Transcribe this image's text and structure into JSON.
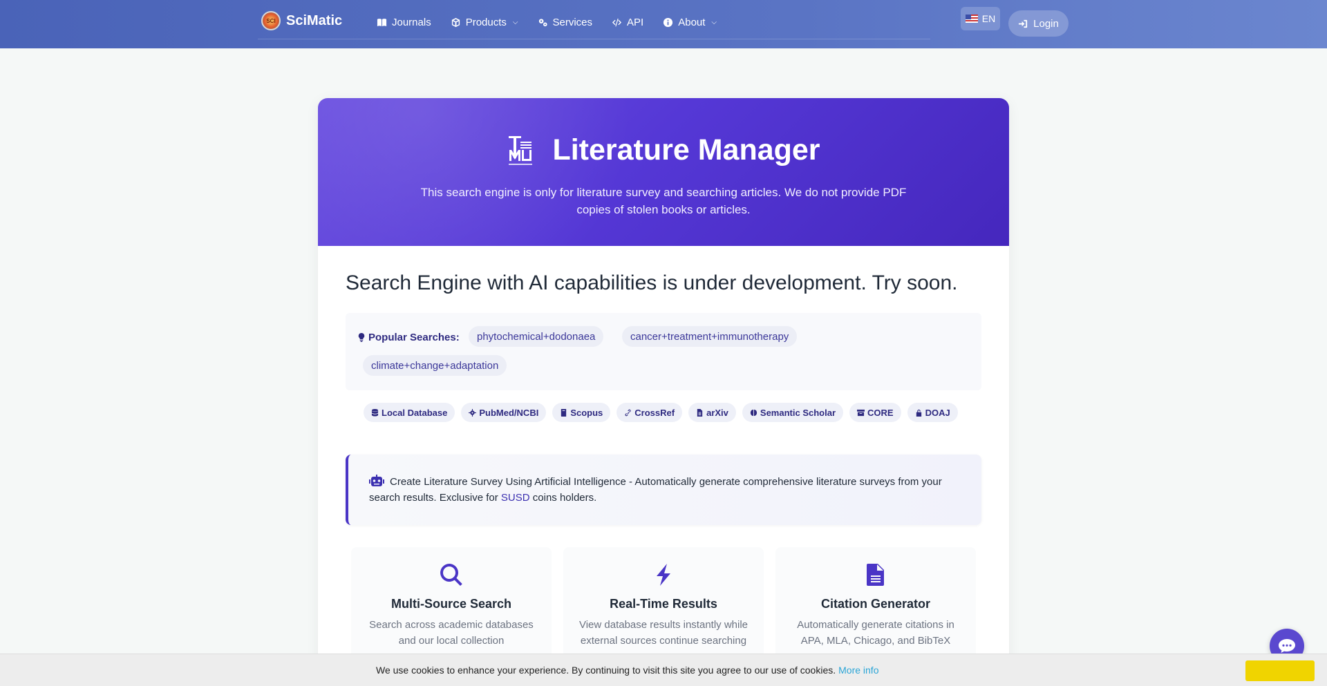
{
  "navbar": {
    "brand": "SciMatic",
    "logo_text": "SCI",
    "items": [
      {
        "label": "Journals",
        "icon": "book-icon",
        "dropdown": false
      },
      {
        "label": "Products",
        "icon": "box-icon",
        "dropdown": true
      },
      {
        "label": "Services",
        "icon": "gears-icon",
        "dropdown": false
      },
      {
        "label": "API",
        "icon": "code-icon",
        "dropdown": false
      },
      {
        "label": "About",
        "icon": "info-circle-icon",
        "dropdown": true
      }
    ],
    "language": "EN",
    "login_label": "Login"
  },
  "hero": {
    "title": "Literature Manager",
    "subtitle": "This search engine is only for literature survey and searching articles. We do not provide PDF copies of stolen books or articles."
  },
  "main": {
    "heading": "Search Engine with AI capabilities is under development. Try soon."
  },
  "popular": {
    "label": "Popular Searches:",
    "tags": [
      "phytochemical+dodonaea",
      "cancer+treatment+immunotherapy",
      "climate+change+adaptation"
    ]
  },
  "sources": [
    {
      "label": "Local Database",
      "icon": "database-icon"
    },
    {
      "label": "PubMed/NCBI",
      "icon": "virus-icon"
    },
    {
      "label": "Scopus",
      "icon": "book-icon"
    },
    {
      "label": "CrossRef",
      "icon": "link-icon"
    },
    {
      "label": "arXiv",
      "icon": "file-icon"
    },
    {
      "label": "Semantic Scholar",
      "icon": "brain-icon"
    },
    {
      "label": "CORE",
      "icon": "archive-icon"
    },
    {
      "label": "DOAJ",
      "icon": "unlock-icon"
    }
  ],
  "ai_box": {
    "text_before": "Create Literature Survey Using Artificial Intelligence - Automatically generate comprehensive literature surveys from your search results. Exclusive for",
    "link": "SUSD",
    "text_after": "coins holders."
  },
  "features": [
    {
      "title": "Multi-Source Search",
      "desc": "Search across academic databases and our local collection",
      "icon": "search-icon"
    },
    {
      "title": "Real-Time Results",
      "desc": "View database results instantly while external sources continue searching",
      "icon": "bolt-icon"
    },
    {
      "title": "Citation Generator",
      "desc": "Automatically generate citations in APA, MLA, Chicago, and BibTeX",
      "icon": "document-icon"
    }
  ],
  "cookie": {
    "text": "We use cookies to enhance your experience. By continuing to visit this site you agree to our use of cookies.",
    "link": "More info",
    "button": ""
  },
  "colors": {
    "navbar": "#5a74c4",
    "hero": "#5538d6",
    "accent": "#4a35c6",
    "cookie_button": "#f0d400",
    "link": "#2aa5d6"
  }
}
